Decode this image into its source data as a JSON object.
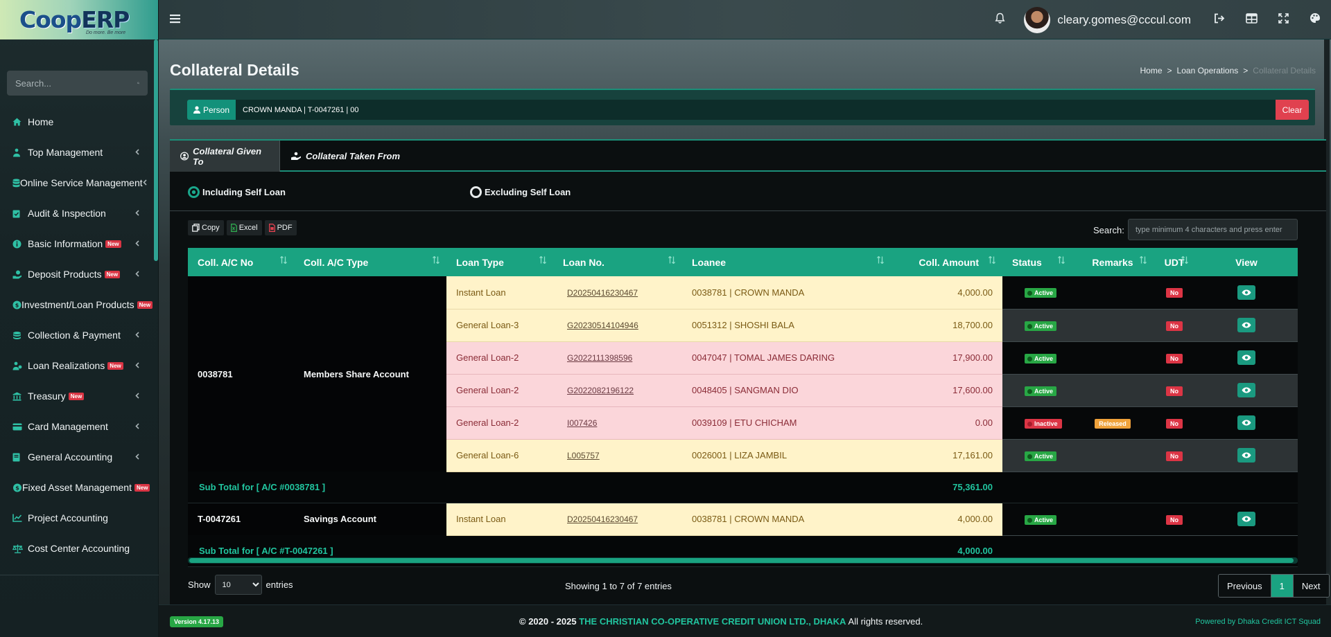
{
  "app": {
    "logo_coop": "Coop",
    "logo_erp": "ERP",
    "logo_tagline": "Do more. Be more",
    "user_email": "cleary.gomes@cccul.com"
  },
  "sidebar": {
    "search_placeholder": "Search...",
    "new_badge": "New",
    "items": [
      {
        "label": "Home",
        "icon": "home-icon",
        "chevron": false,
        "new": false
      },
      {
        "label": "Top Management",
        "icon": "person-tie-icon",
        "chevron": true,
        "new": false
      },
      {
        "label": "Online Service Management",
        "icon": "database-icon",
        "chevron": true,
        "new": false
      },
      {
        "label": "Audit & Inspection",
        "icon": "clipboard-check-icon",
        "chevron": true,
        "new": false
      },
      {
        "label": "Basic Information",
        "icon": "info-circle-icon",
        "chevron": true,
        "new": true
      },
      {
        "label": "Deposit Products",
        "icon": "hand-coin-icon",
        "chevron": true,
        "new": true
      },
      {
        "label": "Investment/Loan Products",
        "icon": "money-circle-icon",
        "chevron": false,
        "new": true
      },
      {
        "label": "Collection & Payment",
        "icon": "coins-icon",
        "chevron": true,
        "new": false
      },
      {
        "label": "Loan Realizations",
        "icon": "person-money-icon",
        "chevron": true,
        "new": true
      },
      {
        "label": "Treasury",
        "icon": "bank-icon",
        "chevron": true,
        "new": true
      },
      {
        "label": "Card Management",
        "icon": "card-icon",
        "chevron": true,
        "new": false
      },
      {
        "label": "General Accounting",
        "icon": "book-icon",
        "chevron": true,
        "new": false
      },
      {
        "label": "Fixed Asset Management",
        "icon": "asset-icon",
        "chevron": false,
        "new": true
      },
      {
        "label": "Project Accounting",
        "icon": "chart-line-icon",
        "chevron": false,
        "new": false
      },
      {
        "label": "Cost Center Accounting",
        "icon": "scale-icon",
        "chevron": false,
        "new": false
      }
    ]
  },
  "page": {
    "title": "Collateral Details",
    "breadcrumb": [
      "Home",
      "Loan Operations",
      "Collateral Details"
    ]
  },
  "person": {
    "button_label": "Person",
    "value": "CROWN MANDA | T-0047261 | 00",
    "clear_label": "Clear"
  },
  "tabs": [
    {
      "label": "Collateral Given To",
      "active": true
    },
    {
      "label": "Collateral Taken From",
      "active": false
    }
  ],
  "radios": [
    {
      "label": "Including Self Loan",
      "checked": true
    },
    {
      "label": "Excluding Self Loan",
      "checked": false
    }
  ],
  "exports": [
    "Copy",
    "Excel",
    "PDF"
  ],
  "search": {
    "label": "Search:",
    "placeholder": "type minimum 4 characters and press enter"
  },
  "table": {
    "columns": [
      "Coll. A/C No",
      "Coll. A/C Type",
      "Loan Type",
      "Loan No.",
      "Loanee",
      "Coll. Amount",
      "Status",
      "Remarks",
      "UDT",
      "View"
    ],
    "groups": [
      {
        "acc_no": "0038781",
        "acc_type": "Members Share Account",
        "rows": [
          {
            "loan_type": "Instant Loan",
            "loan_no": "D20250416230467",
            "loanee": "0038781 | CROWN MANDA",
            "amount": "4,000.00",
            "status": "Active",
            "remarks": "",
            "udt": "No",
            "tone": "yellow"
          },
          {
            "loan_type": "General Loan-3",
            "loan_no": "G20230514104946",
            "loanee": "0051312 | SHOSHI BALA",
            "amount": "18,700.00",
            "status": "Active",
            "remarks": "",
            "udt": "No",
            "tone": "yellow"
          },
          {
            "loan_type": "General Loan-2",
            "loan_no": "G2022111398596",
            "loanee": "0047047 | TOMAL JAMES DARING",
            "amount": "17,900.00",
            "status": "Active",
            "remarks": "",
            "udt": "No",
            "tone": "pink"
          },
          {
            "loan_type": "General Loan-2",
            "loan_no": "G2022082196122",
            "loanee": "0048405 | SANGMAN DIO",
            "amount": "17,600.00",
            "status": "Active",
            "remarks": "",
            "udt": "No",
            "tone": "pink"
          },
          {
            "loan_type": "General Loan-2",
            "loan_no": "I007426",
            "loanee": "0039109 | ETU CHICHAM",
            "amount": "0.00",
            "status": "Inactive",
            "remarks": "Released",
            "udt": "No",
            "tone": "pink"
          },
          {
            "loan_type": "General Loan-6",
            "loan_no": "L005757",
            "loanee": "0026001 | LIZA JAMBIL",
            "amount": "17,161.00",
            "status": "Active",
            "remarks": "",
            "udt": "No",
            "tone": "yellow"
          }
        ],
        "subtotal_label": "Sub Total for [ A/C #0038781 ]",
        "subtotal_amount": "75,361.00"
      },
      {
        "acc_no": "T-0047261",
        "acc_type": "Savings Account",
        "rows": [
          {
            "loan_type": "Instant Loan",
            "loan_no": "D20250416230467",
            "loanee": "0038781 | CROWN MANDA",
            "amount": "4,000.00",
            "status": "Active",
            "remarks": "",
            "udt": "No",
            "tone": "yellow"
          }
        ],
        "subtotal_label": "Sub Total for [ A/C #T-0047261 ]",
        "subtotal_amount": "4,000.00"
      }
    ]
  },
  "pagination": {
    "show_label": "Show",
    "entries_label": "entries",
    "page_size": "10",
    "info": "Showing 1 to 7 of 7 entries",
    "previous": "Previous",
    "current": "1",
    "next": "Next"
  },
  "footer": {
    "version": "Version 4.17.13",
    "copyright_prefix": "© 2020 - 2025",
    "org": "THE CHRISTIAN CO-OPERATIVE CREDIT UNION LTD., DHAKA",
    "rights": "All rights reserved.",
    "powered": "Powered by Dhaka Credit ICT Squad"
  },
  "colors": {
    "accent": "#1aa381",
    "danger": "#dc3545",
    "success": "#28a745",
    "warning": "#f0a23b",
    "row_yellow": "#fff3c9",
    "row_pink": "#fbd6da"
  }
}
